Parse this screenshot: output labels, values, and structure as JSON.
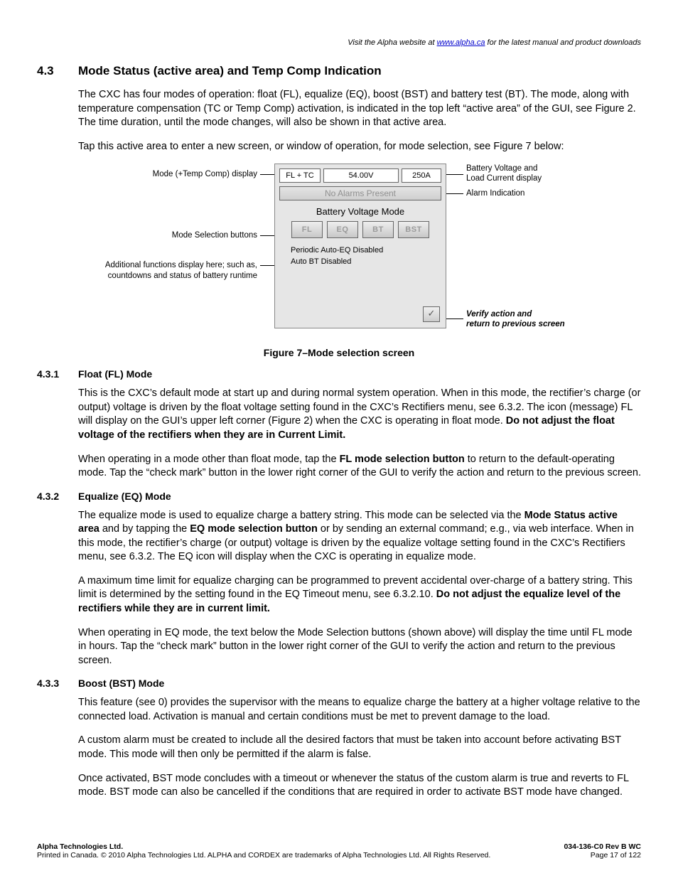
{
  "header": {
    "prefix": "Visit the Alpha website at ",
    "link": "www.alpha.ca",
    "suffix": " for the latest manual and product downloads"
  },
  "h2": {
    "num": "4.3",
    "title": "Mode Status (active area) and Temp Comp Indication"
  },
  "p1": "The CXC has four modes of operation: float (FL), equalize (EQ), boost (BST) and battery test (BT). The mode, along with temperature compensation (TC or Temp Comp) activation, is indicated in the top left “active area” of the GUI, see Figure 2. The time duration, until the mode changes, will also be shown in that active area.",
  "p2": "Tap this active area to enter a new screen, or window of operation, for mode selection, see Figure 7 below:",
  "callouts": {
    "modeDisp": "Mode (+Temp Comp) display",
    "modeSel": "Mode Selection buttons",
    "addl1": "Additional functions display here; such as,",
    "addl2": "countdowns and status of battery runtime",
    "batt1": "Battery Voltage and",
    "batt2": "Load Current display",
    "alarm": "Alarm Indication",
    "verify1": "Verify action and",
    "verify2": "return to previous screen"
  },
  "panel": {
    "mode": "FL + TC",
    "volts": "54.00V",
    "amps": "250A",
    "alarmtext": "No Alarms Present",
    "title": "Battery Voltage Mode",
    "b1": "FL",
    "b2": "EQ",
    "b3": "BT",
    "b4": "BST",
    "s1": "Periodic Auto-EQ Disabled",
    "s2": "Auto BT Disabled",
    "check": "✓"
  },
  "figcap": "Figure 7–Mode selection screen",
  "s431": {
    "num": "4.3.1",
    "title": "Float (FL) Mode"
  },
  "p431a_1": "This is the CXC’s default mode at start up and during normal system operation. When in this mode, the rectifier’s charge (or output) voltage is driven by the float voltage setting found in the CXC’s Rectifiers menu, see 6.3.2. The icon (message) FL will display on the GUI’s upper left corner (Figure 2) when the CXC is operating in float mode. ",
  "p431a_bold": "Do not adjust the float voltage of the rectifiers when they are in Current Limit.",
  "p431b_1": "When operating in a mode other than float mode, tap the ",
  "p431b_bold": "FL mode selection button",
  "p431b_2": " to return to the default-operating mode. Tap the “check mark” button in the lower right corner of the GUI to verify the action and return to the previous screen.",
  "s432": {
    "num": "4.3.2",
    "title": "Equalize (EQ) Mode"
  },
  "p432a_1": "The equalize mode is used to equalize charge a battery string. This mode can be selected via the ",
  "p432a_b1": "Mode Status active area",
  "p432a_2": " and by tapping the ",
  "p432a_b2": "EQ mode selection button",
  "p432a_3": " or by sending an external command; e.g., via web interface. When in this mode, the rectifier’s charge (or output) voltage is driven by the equalize voltage setting found in the CXC’s Rectifiers menu, see 6.3.2. The EQ icon will display when the CXC is operating in equalize mode.",
  "p432b_1": "A maximum time limit for equalize charging can be programmed to prevent accidental over-charge of a battery string. This limit is determined by the setting found in the EQ Timeout menu, see 6.3.2.10. ",
  "p432b_bold": "Do not adjust the equalize level of the rectifiers while they are in current limit.",
  "p432c": "When operating in EQ mode, the text below the Mode Selection buttons (shown above) will display the time until FL mode in hours. Tap the “check mark” button in the lower right corner of the GUI to verify the action and return to the previous screen.",
  "s433": {
    "num": "4.3.3",
    "title": "Boost (BST) Mode"
  },
  "p433a": "This feature (see 0) provides the supervisor with the means to equalize charge the battery at a higher voltage relative to the connected load. Activation is manual and certain conditions must be met to prevent damage to the load.",
  "p433b": "A custom alarm must be created to include all the desired factors that must be taken into account before activating BST mode. This mode will then only be permitted if the alarm is false.",
  "p433c": "Once activated, BST mode concludes with a timeout or whenever the status of the custom alarm is true and reverts to FL mode. BST mode can also be cancelled if the conditions that are required in order to activate BST mode have changed.",
  "footer": {
    "company": "Alpha Technologies Ltd.",
    "legal": "Printed in Canada.  © 2010 Alpha Technologies Ltd.  ALPHA and CORDEX are trademarks of Alpha Technologies Ltd.  All Rights Reserved.",
    "doc": "034-136-C0  Rev B  WC",
    "page": "Page 17 of 122"
  }
}
